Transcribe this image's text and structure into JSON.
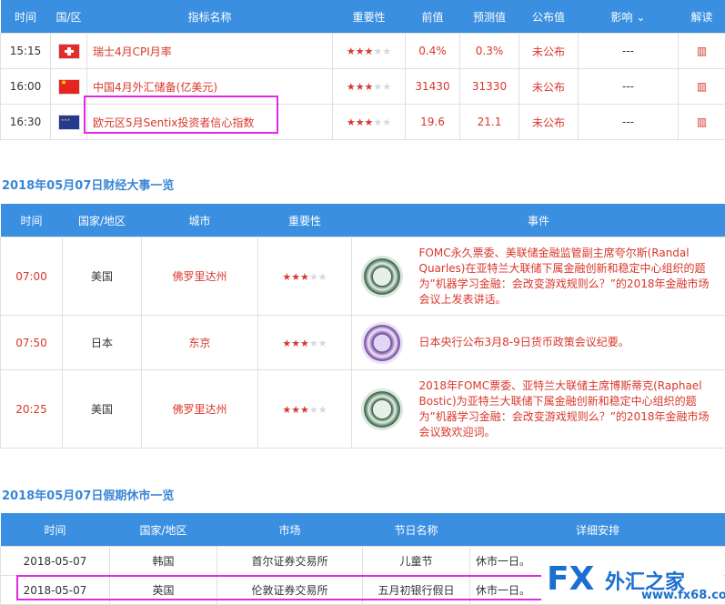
{
  "table1": {
    "headers": [
      "时间",
      "国/区",
      "指标名称",
      "重要性",
      "前值",
      "预测值",
      "公布值",
      "影响",
      "解读"
    ],
    "rows": [
      {
        "time": "15:15",
        "flag": "switzerland-flag-icon",
        "name": "瑞士4月CPI月率",
        "stars": 3,
        "prev": "0.4%",
        "forecast": "0.3%",
        "actual": "未公布",
        "impact": "---"
      },
      {
        "time": "16:00",
        "flag": "china-flag-icon",
        "name": "中国4月外汇储备(亿美元)",
        "stars": 3,
        "prev": "31430",
        "forecast": "31330",
        "actual": "未公布",
        "impact": "---"
      },
      {
        "time": "16:30",
        "flag": "eu-flag-icon",
        "name": "欧元区5月Sentix投资者信心指数",
        "stars": 3,
        "prev": "19.6",
        "forecast": "21.1",
        "actual": "未公布",
        "impact": "---"
      }
    ]
  },
  "section2": {
    "title": "2018年05月07日财经大事一览",
    "headers": [
      "时间",
      "国家/地区",
      "城市",
      "重要性",
      "事件"
    ],
    "rows": [
      {
        "time": "07:00",
        "country": "美国",
        "city": "佛罗里达州",
        "stars": 3,
        "seal": "fed-seal-icon",
        "event": "FOMC永久票委、美联储金融监管副主席夸尔斯(Randal Quarles)在亚特兰大联储下属金融创新和稳定中心组织的题为”机器学习金融：会改变游戏规则么？”的2018年金融市场会议上发表讲话。"
      },
      {
        "time": "07:50",
        "country": "日本",
        "city": "东京",
        "stars": 3,
        "seal": "boj-seal-icon",
        "event": "日本央行公布3月8-9日货币政策会议纪要。"
      },
      {
        "time": "20:25",
        "country": "美国",
        "city": "佛罗里达州",
        "stars": 3,
        "seal": "fed-seal-icon",
        "event": "2018年FOMC票委、亚特兰大联储主席博斯蒂克(Raphael Bostic)为亚特兰大联储下属金融创新和稳定中心组织的题为”机器学习金融：会改变游戏规则么？”的2018年金融市场会议致欢迎词。"
      }
    ]
  },
  "section3": {
    "title": "2018年05月07日假期休市一览",
    "headers": [
      "时间",
      "国家/地区",
      "市场",
      "节日名称",
      "详细安排"
    ],
    "rows": [
      {
        "date": "2018-05-07",
        "country": "韩国",
        "market": "首尔证券交易所",
        "holiday": "儿童节",
        "detail": "休市一日。"
      },
      {
        "date": "2018-05-07",
        "country": "英国",
        "market": "伦敦证券交易所",
        "holiday": "五月初银行假日",
        "detail": "休市一日。"
      }
    ]
  },
  "watermark": {
    "logo": "FX",
    "name": "外汇之家",
    "url": "www.fx68.com"
  },
  "colors": {
    "header_bg": "#3a8fe0",
    "link_red": "#d9372b",
    "highlight": "#e02ae0",
    "title_blue": "#3a86d6"
  }
}
